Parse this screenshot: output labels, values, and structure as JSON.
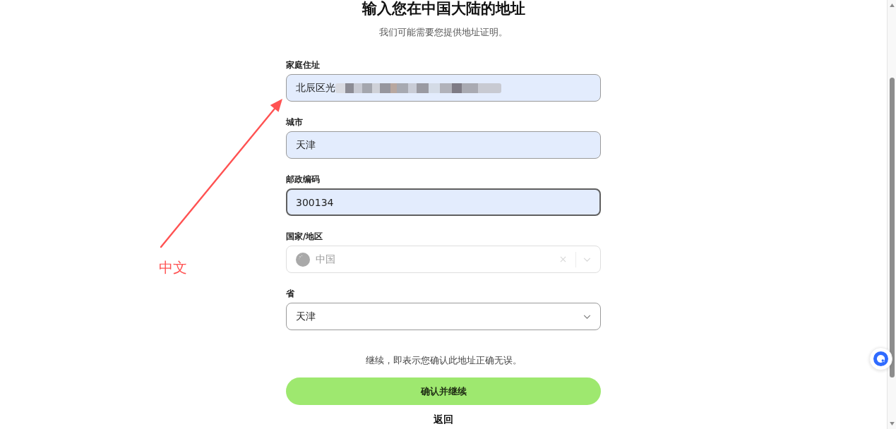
{
  "header": {
    "title": "输入您在中国大陆的地址",
    "subtitle": "我们可能需要您提供地址证明。"
  },
  "fields": [
    {
      "kind": "text",
      "label": "家庭住址",
      "value": "北辰区光",
      "autofilled": true,
      "focused": false,
      "redacted": true,
      "disabled": false,
      "clearable": false
    },
    {
      "kind": "text",
      "label": "城市",
      "value": "天津",
      "autofilled": true,
      "focused": false,
      "redacted": false,
      "disabled": false,
      "clearable": false
    },
    {
      "kind": "text",
      "label": "邮政编码",
      "value": "300134",
      "autofilled": true,
      "focused": true,
      "redacted": false,
      "disabled": false,
      "clearable": false
    },
    {
      "kind": "select",
      "label": "国家/地区",
      "value": "中国",
      "autofilled": false,
      "focused": false,
      "redacted": false,
      "disabled": true,
      "clearable": true
    },
    {
      "kind": "select",
      "label": "省",
      "value": "天津",
      "autofilled": false,
      "focused": false,
      "redacted": false,
      "disabled": false,
      "clearable": false
    }
  ],
  "consent_note": "继续，即表示您确认此地址正确无误。",
  "primary_button": {
    "label": "确认并继续"
  },
  "back_link": {
    "label": "返回"
  },
  "annotation": {
    "label": "中文"
  }
}
